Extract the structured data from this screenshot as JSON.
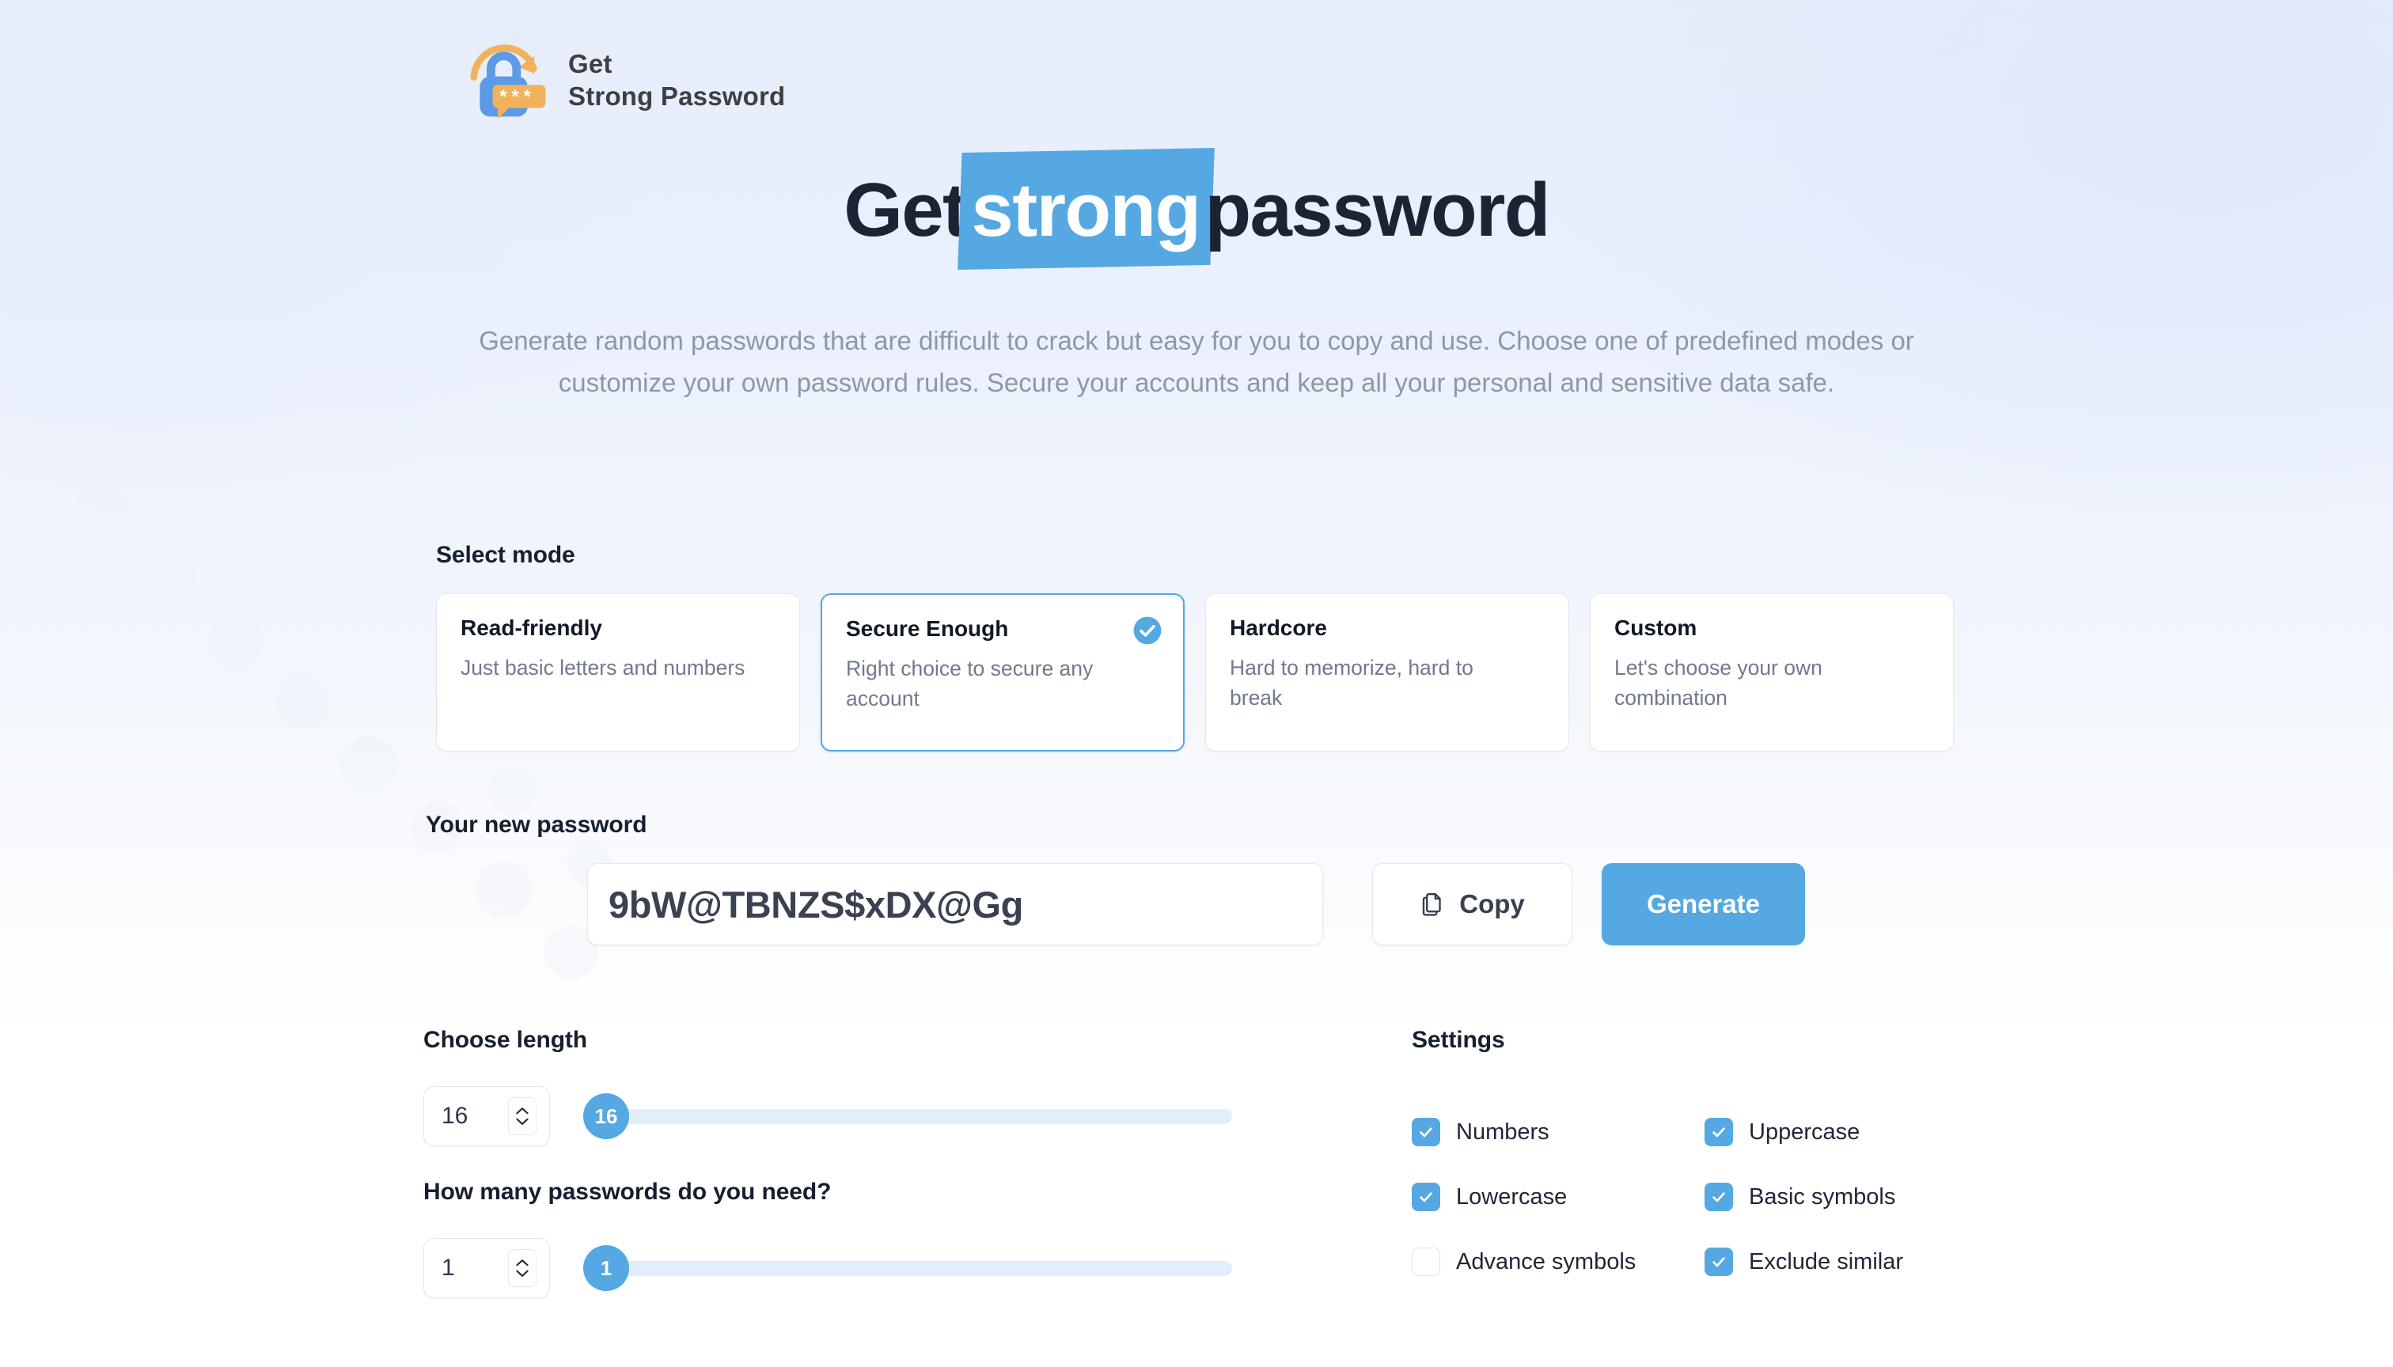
{
  "brand": {
    "logo_icon": "padlock-refresh-asterisks-icon",
    "name_line1": "Get",
    "name_line2": "Strong Password"
  },
  "hero": {
    "title_prefix": "Get",
    "title_highlight": "strong",
    "title_suffix": "password",
    "description": "Generate random passwords that are difficult to crack but easy for you to copy and use. Choose one of predefined modes or customize your own password rules. Secure your accounts and keep all your personal and sensitive data safe."
  },
  "mode_section": {
    "label": "Select mode",
    "selected_index": 1,
    "modes": [
      {
        "name": "Read-friendly",
        "desc": "Just basic letters and numbers",
        "selected": false
      },
      {
        "name": "Secure Enough",
        "desc": "Right choice to secure any account",
        "selected": true
      },
      {
        "name": "Hardcore",
        "desc": "Hard to memorize, hard to break",
        "selected": false
      },
      {
        "name": "Custom",
        "desc": "Let's choose your own combination",
        "selected": false
      }
    ]
  },
  "password_section": {
    "label": "Your new password",
    "value": "9bW@TBNZS$xDX@Gg",
    "placeholder": "Your new password",
    "copy_label": "Copy",
    "copy_icon": "copy-icon",
    "generate_label": "Generate"
  },
  "length_section": {
    "label": "Choose length",
    "value": "16",
    "slider_value": 16,
    "slider_min": 1,
    "slider_max": 64
  },
  "count_section": {
    "label": "How many passwords do you need?",
    "value": "1",
    "slider_value": 1,
    "slider_min": 1,
    "slider_max": 50
  },
  "settings_section": {
    "label": "Settings",
    "options": [
      {
        "label": "Numbers",
        "checked": true
      },
      {
        "label": "Uppercase",
        "checked": true
      },
      {
        "label": "Lowercase",
        "checked": true
      },
      {
        "label": "Basic symbols",
        "checked": true
      },
      {
        "label": "Advance symbols",
        "checked": false
      },
      {
        "label": "Exclude similar",
        "checked": true
      }
    ]
  },
  "colors": {
    "accent": "#55a8e2",
    "accent_track": "#e2eefb",
    "logo_orange": "#f2b25c",
    "logo_blue": "#5b9ae4",
    "text_dark": "#1c2333",
    "text_muted": "#8e97a8",
    "border": "#e6e8ec",
    "bg_top": "#e6edfa",
    "bg_bottom": "#ffffff"
  }
}
